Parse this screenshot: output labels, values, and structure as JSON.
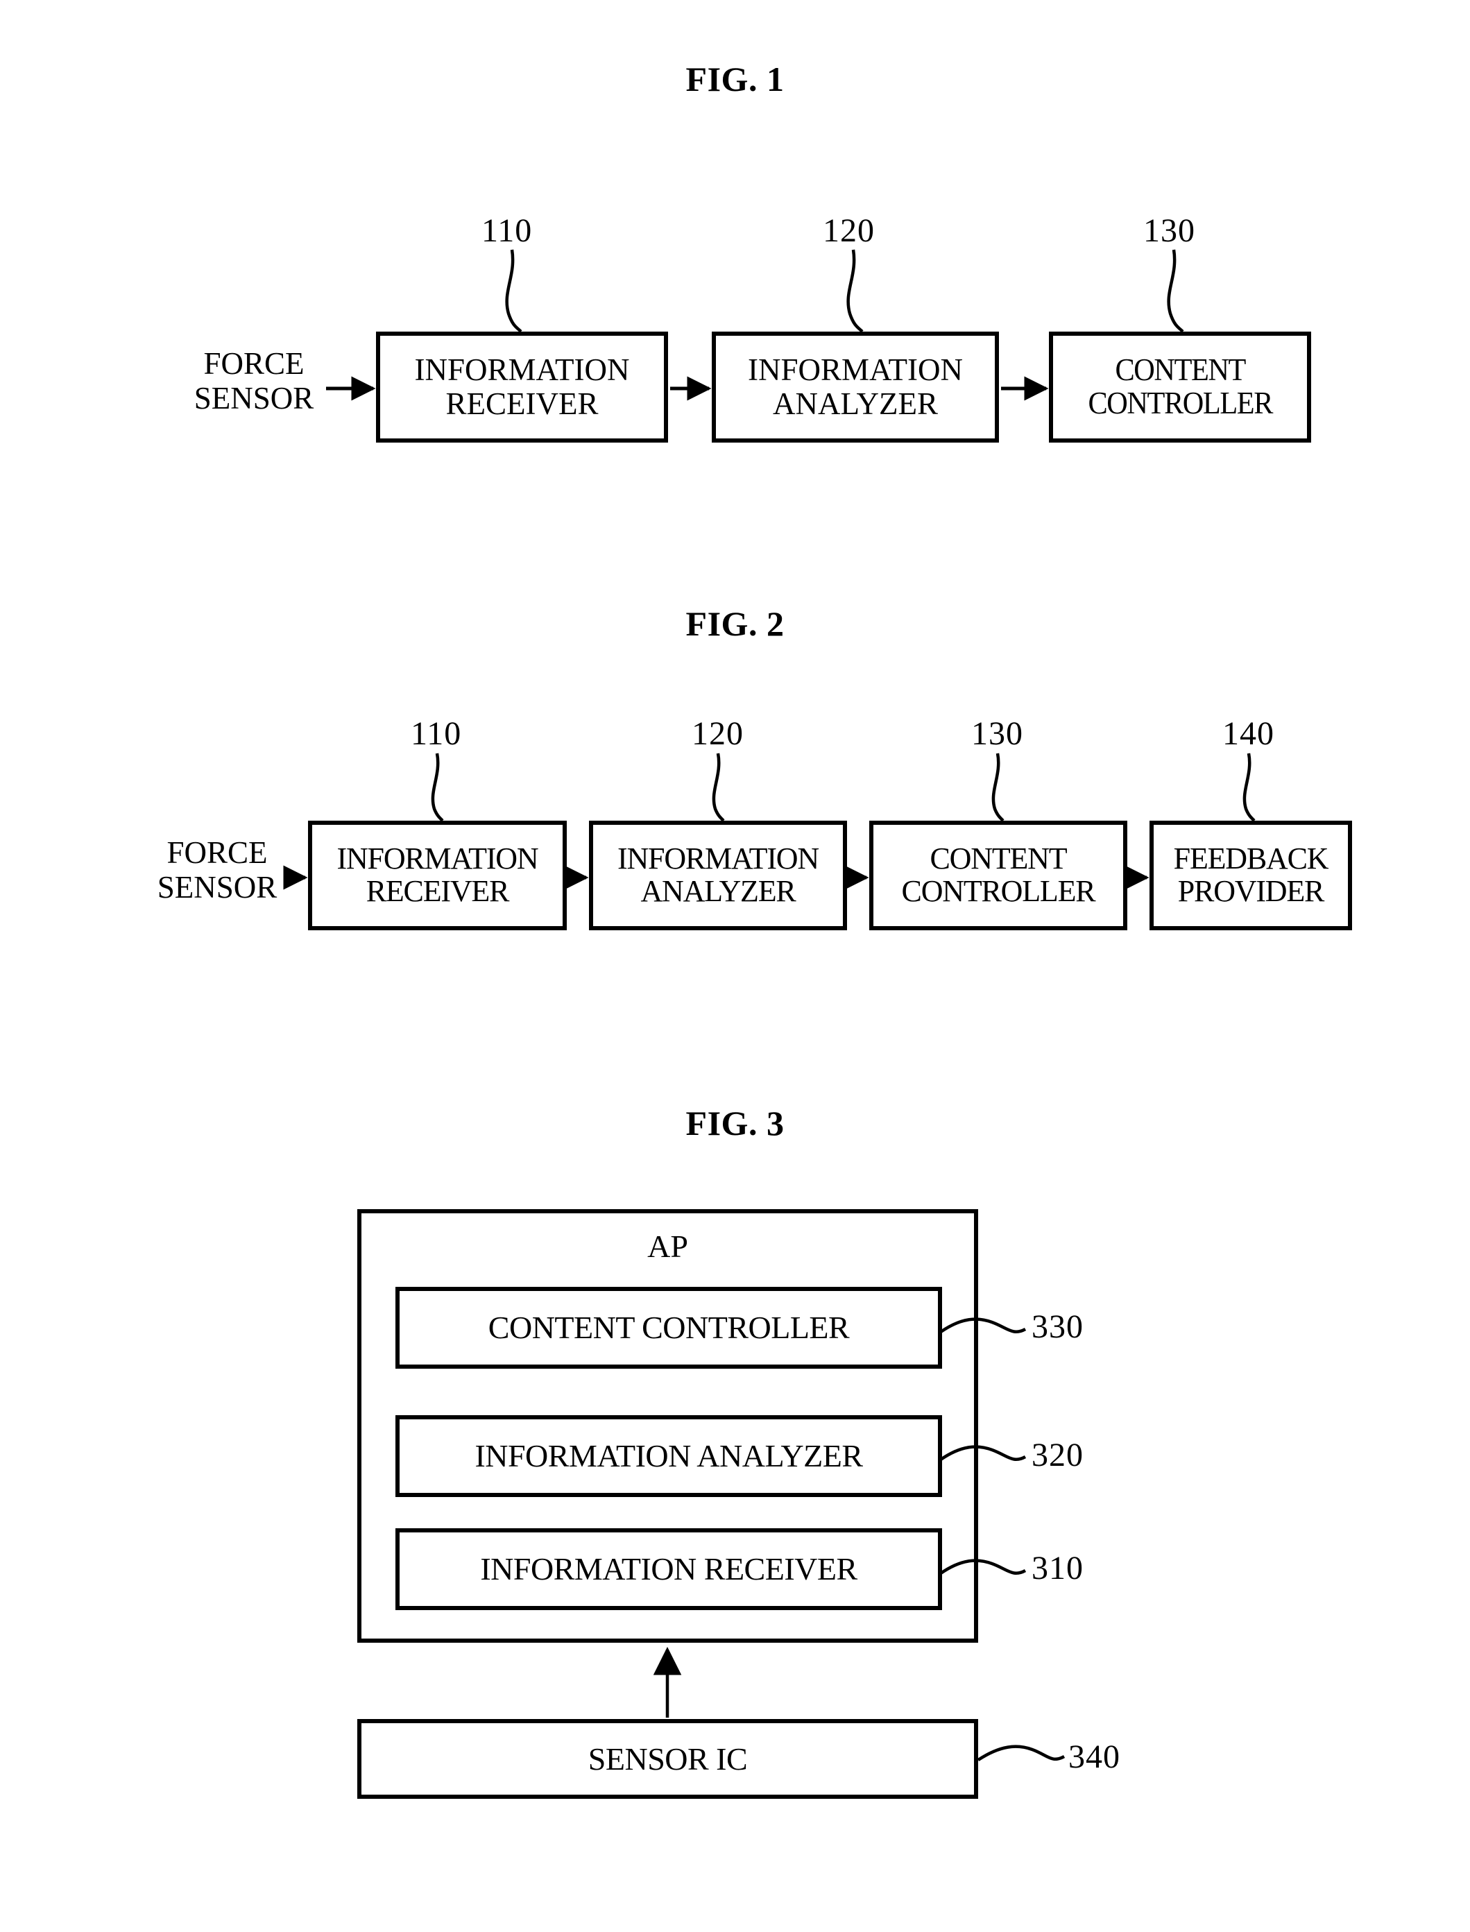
{
  "figures": [
    {
      "title": "FIG. 1",
      "external_label": "FORCE\nSENSOR",
      "boxes": [
        {
          "label": "INFORMATION\nRECEIVER",
          "ref": "110"
        },
        {
          "label": "INFORMATION\nANALYZER",
          "ref": "120"
        },
        {
          "label": "CONTENT\nCONTROLLER",
          "ref": "130"
        }
      ]
    },
    {
      "title": "FIG. 2",
      "external_label": "FORCE\nSENSOR",
      "boxes": [
        {
          "label": "INFORMATION\nRECEIVER",
          "ref": "110"
        },
        {
          "label": "INFORMATION\nANALYZER",
          "ref": "120"
        },
        {
          "label": "CONTENT\nCONTROLLER",
          "ref": "130"
        },
        {
          "label": "FEEDBACK\nPROVIDER",
          "ref": "140"
        }
      ]
    },
    {
      "title": "FIG. 3",
      "container_label": "AP",
      "inner_boxes": [
        {
          "label": "CONTENT CONTROLLER",
          "ref": "330"
        },
        {
          "label": "INFORMATION ANALYZER",
          "ref": "320"
        },
        {
          "label": "INFORMATION RECEIVER",
          "ref": "310"
        }
      ],
      "outer_boxes": [
        {
          "label": "SENSOR IC",
          "ref": "340"
        }
      ]
    }
  ],
  "colors": {
    "ink": "#000000",
    "paper": "#ffffff"
  }
}
